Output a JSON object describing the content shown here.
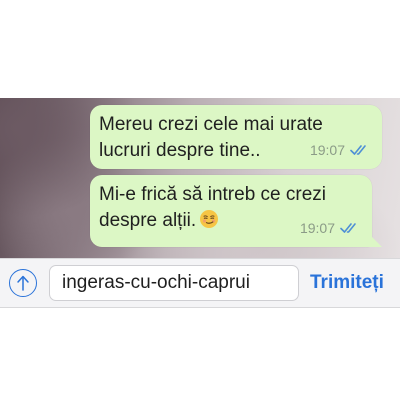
{
  "conversation": {
    "messages": [
      {
        "text": "Mereu crezi cele mai urate\nlucruri despre tine..",
        "time": "19:07",
        "status_icon": "double-check-icon"
      },
      {
        "text": "Mi-e frică să intreb ce crezi\ndespre alții.",
        "emoji": "smirking-face-emoji",
        "time": "19:07",
        "status_icon": "double-check-icon"
      }
    ]
  },
  "composer": {
    "upload_icon": "upload-arrow-icon",
    "input_value": "ingeras-cu-ochi-caprui",
    "send_label": "Trimiteți"
  },
  "colors": {
    "bubble": "#dcf7c5",
    "accent": "#2a73d9",
    "meta": "#8b9b87",
    "check": "#4e8fd6"
  }
}
